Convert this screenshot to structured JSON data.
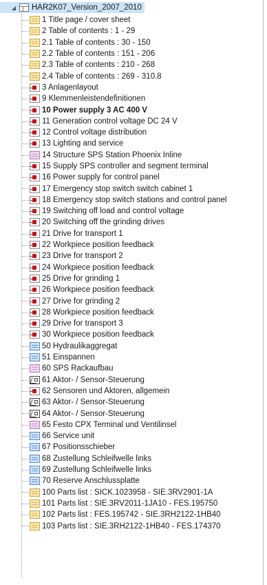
{
  "tree": {
    "root_label": "HAR2K07_Version_2007_2010",
    "items": [
      {
        "label": "1 Title page / cover sheet",
        "icon": "yellow-page-icon"
      },
      {
        "label": "2 Table of contents : 1 - 29",
        "icon": "yellow-page-icon"
      },
      {
        "label": "2.1 Table of contents : 30 - 150",
        "icon": "yellow-page-icon"
      },
      {
        "label": "2.2 Table of contents : 151 - 206",
        "icon": "yellow-page-icon"
      },
      {
        "label": "2.3 Table of contents : 210 - 268",
        "icon": "yellow-page-icon"
      },
      {
        "label": "2.4 Table of contents : 269 - 310.8",
        "icon": "yellow-page-icon"
      },
      {
        "label": "3 Anlagenlayout",
        "icon": "schematic-page-icon"
      },
      {
        "label": "9 Klemmenleistendefinitionen",
        "icon": "schematic-page-icon"
      },
      {
        "label": "10 Power supply 3 AC 400 V",
        "icon": "schematic-page-icon",
        "bold": true
      },
      {
        "label": "11 Generation control voltage DC 24 V",
        "icon": "schematic-page-icon"
      },
      {
        "label": "12 Control voltage distribution",
        "icon": "schematic-page-icon"
      },
      {
        "label": "13 Lighting and service",
        "icon": "schematic-page-icon"
      },
      {
        "label": "14 Structure SPS Station Phoenix Inline",
        "icon": "pink-page-icon"
      },
      {
        "label": "15 Supply SPS controller and segment terminal",
        "icon": "schematic-page-icon"
      },
      {
        "label": "16 Power supply for control panel",
        "icon": "schematic-page-icon"
      },
      {
        "label": "17 Emergency stop switch switch cabinet 1",
        "icon": "schematic-page-icon"
      },
      {
        "label": "18 Emergency stop switch stations and control panel",
        "icon": "schematic-page-icon"
      },
      {
        "label": "19 Switching off load and control voltage",
        "icon": "schematic-page-icon"
      },
      {
        "label": "20 Switching off the grinding drives",
        "icon": "schematic-page-icon"
      },
      {
        "label": "21 Drive for transport 1",
        "icon": "schematic-page-icon"
      },
      {
        "label": "22 Workpiece position feedback",
        "icon": "schematic-page-icon"
      },
      {
        "label": "23 Drive for transport 2",
        "icon": "schematic-page-icon"
      },
      {
        "label": "24 Workpiece position feedback",
        "icon": "schematic-page-icon"
      },
      {
        "label": "25 Drive for grinding 1",
        "icon": "schematic-page-icon"
      },
      {
        "label": "26 Workpiece position feedback",
        "icon": "schematic-page-icon"
      },
      {
        "label": "27 Drive for grinding 2",
        "icon": "schematic-page-icon"
      },
      {
        "label": "28 Workpiece position feedback",
        "icon": "schematic-page-icon"
      },
      {
        "label": "29 Drive for transport 3",
        "icon": "schematic-page-icon"
      },
      {
        "label": "30 Workpiece position feedback",
        "icon": "schematic-page-icon"
      },
      {
        "label": "50 Hydraulikaggregat",
        "icon": "blue-page-icon"
      },
      {
        "label": "51 Einspannen",
        "icon": "blue-page-icon"
      },
      {
        "label": "60 SPS Rackaufbau",
        "icon": "pink-page-icon"
      },
      {
        "label": "61 Aktor- / Sensor-Steuerung",
        "icon": "graphic-page-icon"
      },
      {
        "label": "62 Sensoren und Aktoren, allgemein",
        "icon": "schematic-page-icon"
      },
      {
        "label": "63 Aktor- / Sensor-Steuerung",
        "icon": "graphic-page-icon"
      },
      {
        "label": "64 Aktor- / Sensor-Steuerung",
        "icon": "graphic-page-icon"
      },
      {
        "label": "65 Festo CPX Terminal und Ventilinsel",
        "icon": "pink-page-icon"
      },
      {
        "label": "66 Service unit",
        "icon": "blue-page-icon"
      },
      {
        "label": "67 Positionsschieber",
        "icon": "blue-page-icon"
      },
      {
        "label": "68 Zustellung Schleifwelle links",
        "icon": "blue-page-icon"
      },
      {
        "label": "69 Zustellung Schleifwelle links",
        "icon": "blue-page-icon"
      },
      {
        "label": "70 Reserve Anschlussplatte",
        "icon": "blue-page-icon"
      },
      {
        "label": "100 Parts list : SICK.1023958 - SIE.3RV2901-1A",
        "icon": "yellow-page-icon"
      },
      {
        "label": "101 Parts list : SIE.3RV2011-1JA10 - FES.195750",
        "icon": "yellow-page-icon"
      },
      {
        "label": "102 Parts list : FES.195742 - SIE.3RH2122-1HB40",
        "icon": "yellow-page-icon"
      },
      {
        "label": "103 Parts list : SIE.3RH2122-1HB40 - FES.174370",
        "icon": "yellow-page-icon"
      }
    ]
  },
  "colors": {
    "selection": "#cce4f7",
    "schematic_red": "#c0141b",
    "page_yellow": "#fbe7a6",
    "page_blue": "#cfe3f7",
    "page_pink": "#f0d6ef"
  }
}
